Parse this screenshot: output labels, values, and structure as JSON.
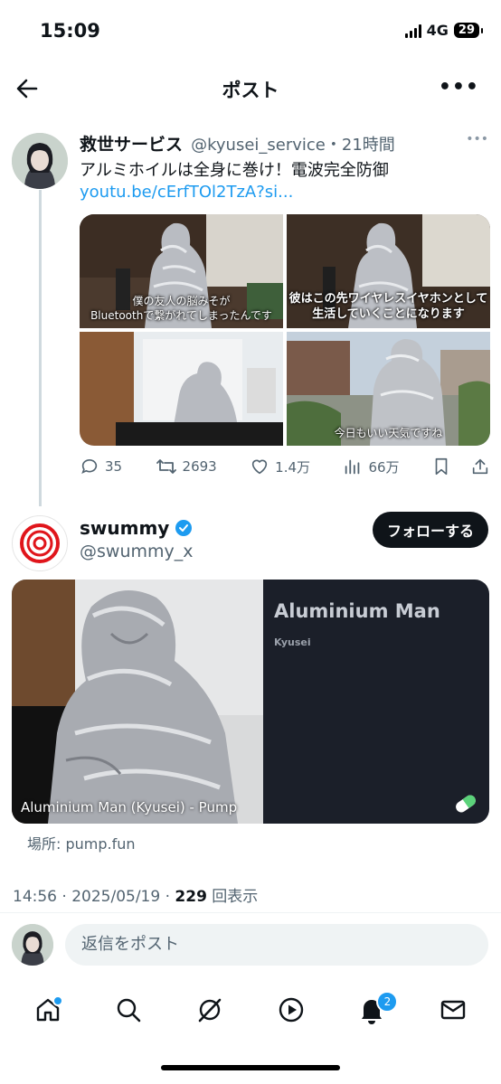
{
  "status_bar": {
    "time": "15:09",
    "network": "4G",
    "battery": "29"
  },
  "header": {
    "title": "ポスト"
  },
  "tweet": {
    "author_name": "救世サービス",
    "handle": "@kyusei_service",
    "time": "・21時間",
    "text": "アルミホイルは全身に巻け！電波完全防御",
    "link": "youtu.be/cErfTOl2TzA?si...",
    "images": [
      {
        "caption_l1": "僕の友人の脳みそが",
        "caption_l2": "Bluetoothで繋がれてしまったんです"
      },
      {
        "caption_l1": "彼はこの先ワイヤレスイヤホンとして",
        "caption_l2": "生活していくことになります"
      },
      {
        "caption_l1": "",
        "caption_l2": ""
      },
      {
        "caption_l1": "今日もいい天気ですね",
        "caption_l2": ""
      }
    ],
    "stats": {
      "replies": "35",
      "retweets": "2693",
      "likes": "1.4万",
      "views": "66万"
    }
  },
  "reply": {
    "author_name": "swummy",
    "handle": "@swummy_x",
    "follow_label": "フォローする",
    "card": {
      "title": "Aluminium Man",
      "subtitle": "Kyusei",
      "image_label": "Aluminium Man (Kyusei) - Pump"
    },
    "place": "場所: pump.fun",
    "timestamp": "14:56 · 2025/05/19 · ",
    "views_count": "229",
    "views_label": " 回表示"
  },
  "composer": {
    "placeholder": "返信をポスト"
  },
  "bottom_nav": {
    "notifications_badge": "2"
  },
  "colors": {
    "accent": "#1d9bf0",
    "text": "#0f1419",
    "muted": "#536471"
  }
}
